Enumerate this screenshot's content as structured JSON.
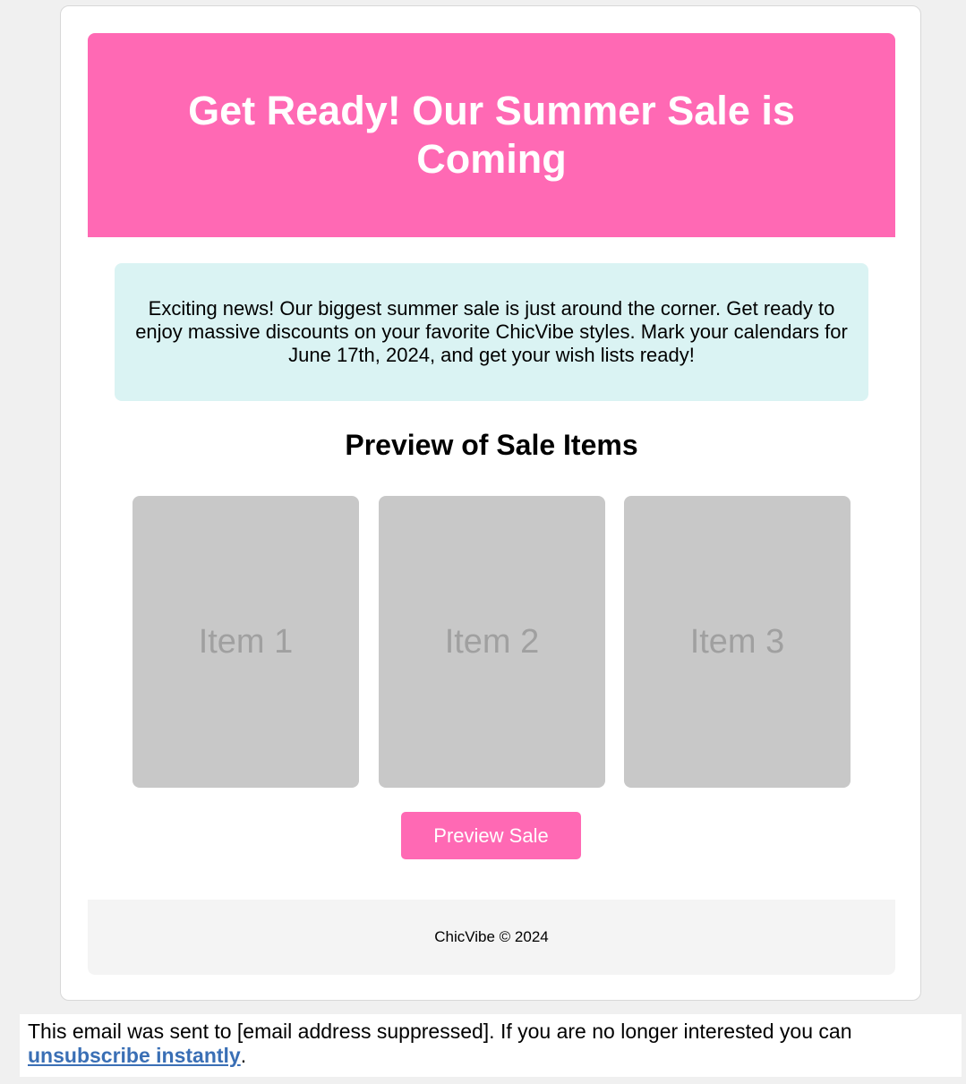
{
  "hero": {
    "title": "Get Ready! Our Summer Sale is Coming"
  },
  "intro": {
    "text": "Exciting news! Our biggest summer sale is just around the corner. Get ready to enjoy massive discounts on your favorite ChicVibe styles. Mark your calendars for June 17th, 2024, and get your wish lists ready!"
  },
  "preview": {
    "title": "Preview of Sale Items",
    "items": [
      {
        "label": "Item 1"
      },
      {
        "label": "Item 2"
      },
      {
        "label": "Item 3"
      }
    ],
    "cta_label": "Preview Sale"
  },
  "footer": {
    "text": "ChicVibe © 2024"
  },
  "unsubscribe": {
    "text_before": "This email was sent to [email address suppressed]. If you are no longer interested you can ",
    "link_label": "unsubscribe instantly",
    "text_after": "."
  },
  "colors": {
    "brand_pink": "#ff69b4",
    "intro_bg": "#daf3f3",
    "placeholder_gray": "#c8c8c8",
    "link_blue": "#3a6fb5"
  }
}
